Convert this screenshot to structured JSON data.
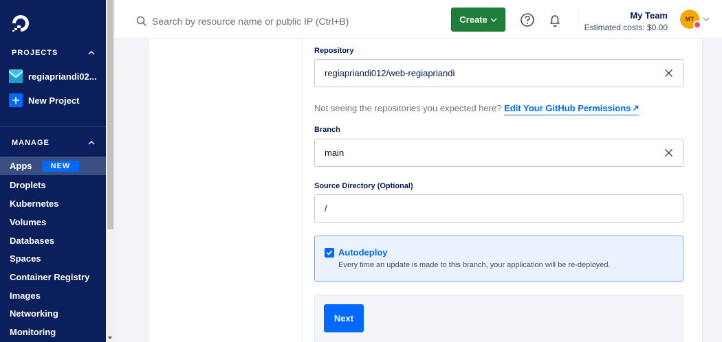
{
  "sidebar": {
    "projects_heading": "PROJECTS",
    "project_name": "regiapriandi02...",
    "new_project_label": "New Project",
    "manage_heading": "MANAGE",
    "apps_badge": "NEW",
    "items": [
      {
        "label": "Apps",
        "active": true
      },
      {
        "label": "Droplets"
      },
      {
        "label": "Kubernetes"
      },
      {
        "label": "Volumes"
      },
      {
        "label": "Databases"
      },
      {
        "label": "Spaces"
      },
      {
        "label": "Container Registry"
      },
      {
        "label": "Images"
      },
      {
        "label": "Networking"
      },
      {
        "label": "Monitoring"
      }
    ]
  },
  "header": {
    "search_placeholder": "Search by resource name or public IP (Ctrl+B)",
    "create_label": "Create",
    "team_name": "My Team",
    "estimated_costs": "Estimated costs: $0.00",
    "avatar_initials": "MT"
  },
  "form": {
    "repository_label": "Repository",
    "repository_value": "regiapriandi012/web-regiapriandi",
    "hint_text": "Not seeing the repositories you expected here?",
    "github_link": "Edit Your GitHub Permissions",
    "branch_label": "Branch",
    "branch_value": "main",
    "source_dir_label": "Source Directory (Optional)",
    "source_dir_value": "/",
    "autodeploy_title": "Autodeploy",
    "autodeploy_checked": true,
    "autodeploy_desc": "Every time an update is made to this branch, your application will be re-deployed.",
    "next_label": "Next"
  },
  "colors": {
    "sidebar_bg": "#0b1f5c",
    "brand_blue": "#0069ff",
    "create_green": "#1f7d3a"
  }
}
